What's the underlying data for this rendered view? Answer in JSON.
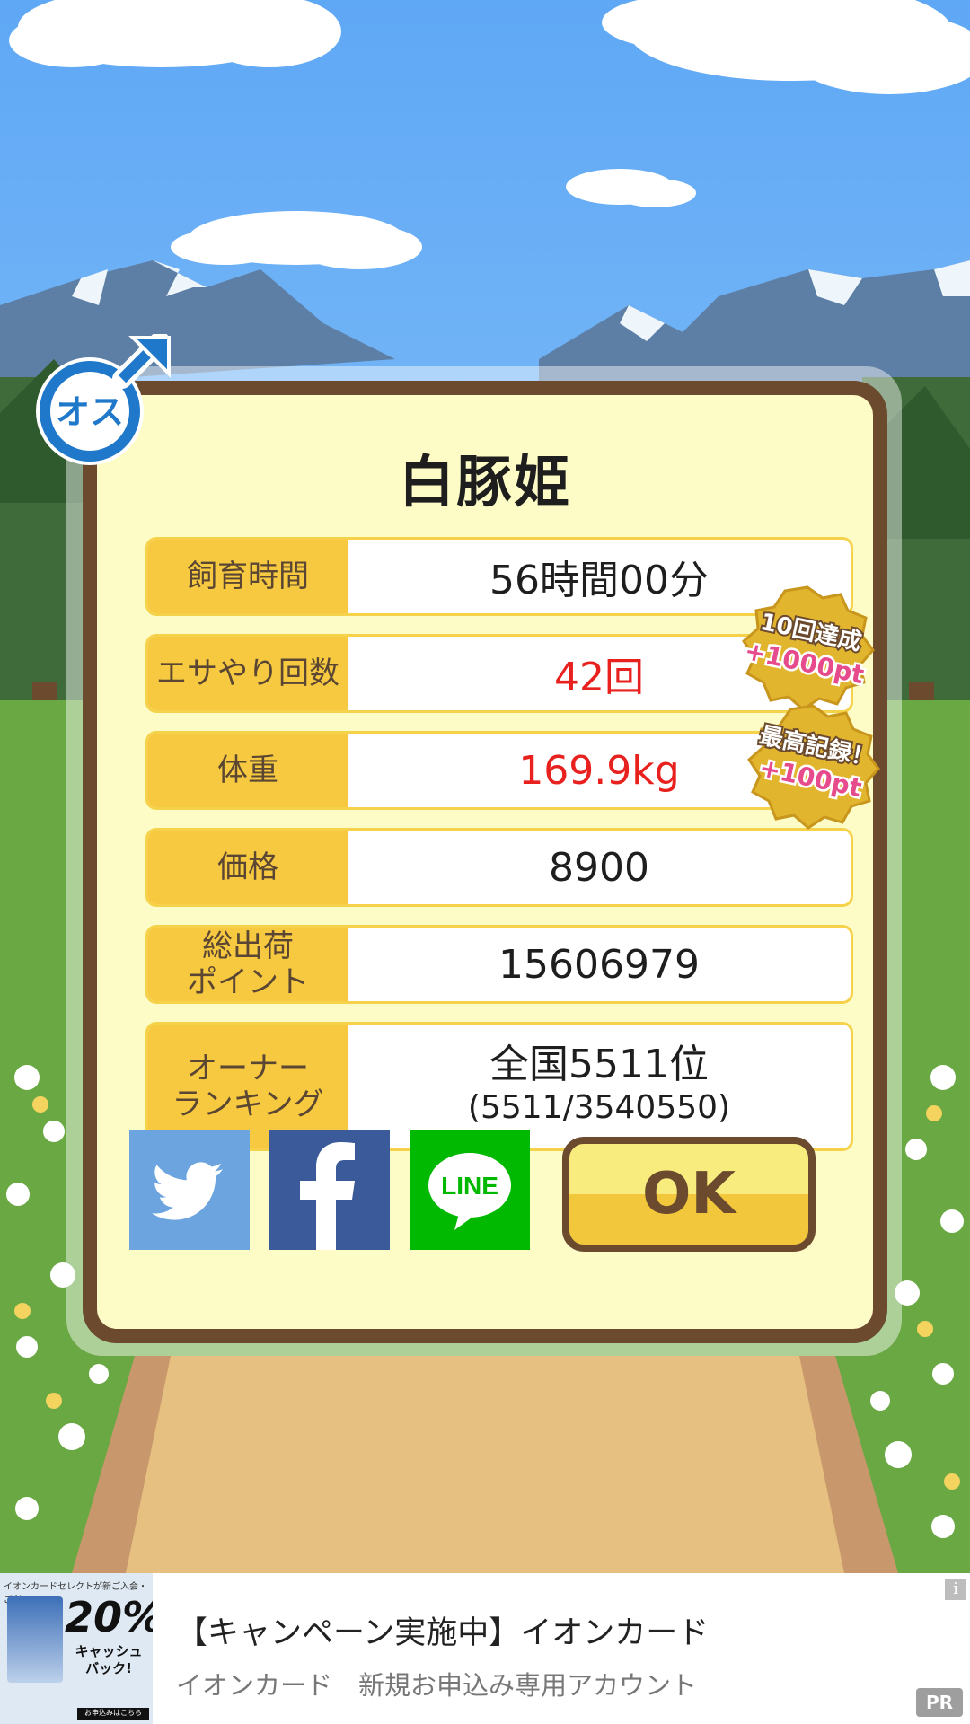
{
  "pig": {
    "name": "白豚姫",
    "gender_badge": "オス"
  },
  "stats": [
    {
      "label": "飼育時間",
      "value": "56時間00分",
      "highlight": false
    },
    {
      "label": "エサやり回数",
      "value": "42回",
      "highlight": true
    },
    {
      "label": "体重",
      "value": "169.9kg",
      "highlight": true
    },
    {
      "label": "価格",
      "value": "8900",
      "highlight": false
    },
    {
      "label": "総出荷\nポイント",
      "value": "15606979",
      "highlight": false
    },
    {
      "label": "オーナー\nランキング",
      "value": "全国5511位",
      "sub_value": "(5511/3540550)",
      "highlight": false
    }
  ],
  "medals": [
    {
      "line1": "10回達成",
      "line2": "+1000pt"
    },
    {
      "line1": "最高記録！",
      "line2": "+100pt"
    }
  ],
  "share": {
    "twitter_icon": "twitter-bird-icon",
    "facebook_icon": "facebook-f-icon",
    "line_label": "LINE"
  },
  "buttons": {
    "ok_label": "OK"
  },
  "ad": {
    "title": "【キャンペーン実施中】イオンカード",
    "subtitle": "イオンカード　新規お申込み専用アカウント",
    "thumb_top": "イオンカードセレクトが新ご入会・ご利用で",
    "thumb_percent": "20%",
    "thumb_cashback": "キャッシュバック!",
    "thumb_footer": "お申込みはこちら",
    "info_label": "i",
    "pr_label": "PR"
  },
  "colors": {
    "frame": "#6b4a2e",
    "label_bg": "#f6c940",
    "highlight_text": "#e8201e",
    "dialog_bg": "#fefcc6"
  }
}
